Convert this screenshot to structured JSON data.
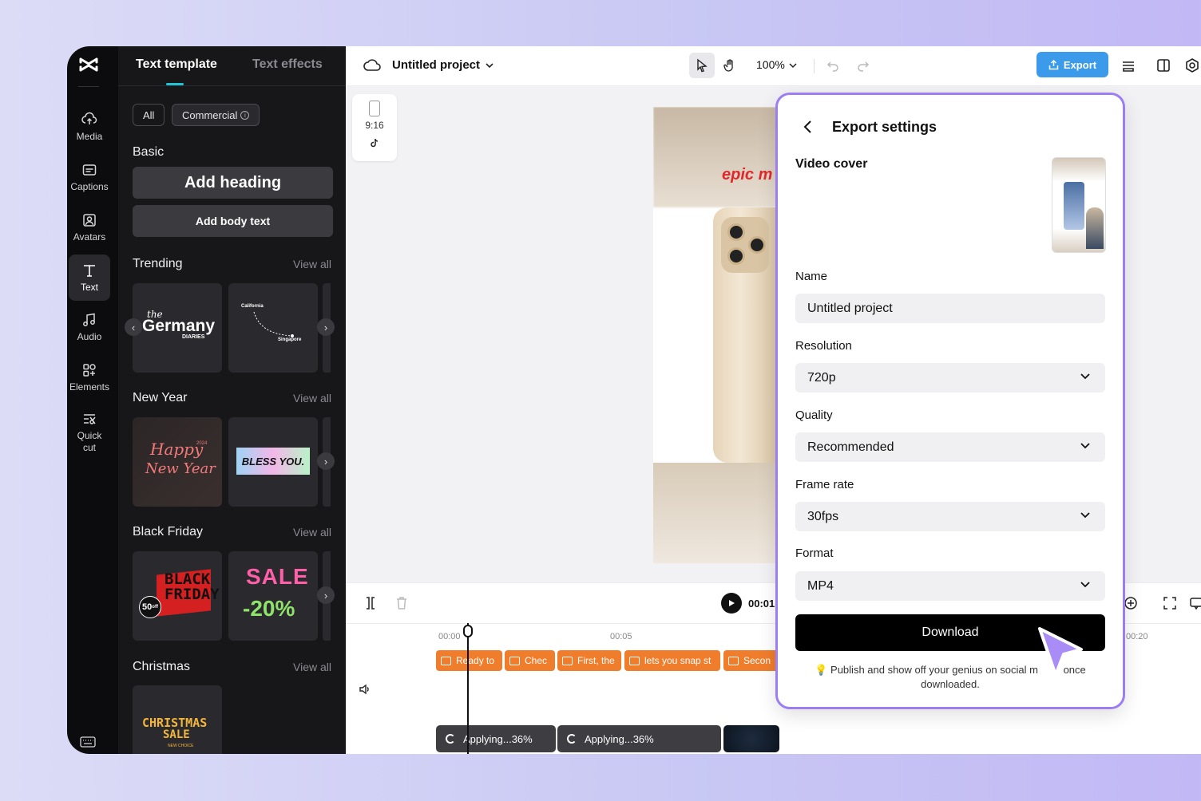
{
  "panel": {
    "tabs": [
      "Text template",
      "Text effects"
    ],
    "filters": {
      "all": "All",
      "commercial": "Commercial"
    },
    "basic": {
      "title": "Basic",
      "heading_btn": "Add heading",
      "body_btn": "Add body text"
    },
    "sections": [
      {
        "title": "Trending",
        "view_all": "View all"
      },
      {
        "title": "New Year",
        "view_all": "View all"
      },
      {
        "title": "Black Friday",
        "view_all": "View all"
      },
      {
        "title": "Christmas",
        "view_all": "View all"
      }
    ],
    "thumb_text": {
      "germany_the": "the",
      "germany": "Germany",
      "germany_sub": "DIARIES",
      "california": "California",
      "singapore": "Singapore",
      "happy": "Happy",
      "happy_year": "2024",
      "new_year": "New Year",
      "bless": "BLESS YOU.",
      "black": "BLACK",
      "friday": "FRIDAY",
      "fifty": "50",
      "off": "off",
      "sale": "SALE",
      "pct": "-20%",
      "christmas": "CHRISTMAS",
      "xsale": "SALE",
      "xsub": "NEW CHOICE"
    }
  },
  "rail": [
    {
      "label": "Media",
      "icon": "cloud-upload-icon"
    },
    {
      "label": "Captions",
      "icon": "captions-icon"
    },
    {
      "label": "Avatars",
      "icon": "avatar-icon"
    },
    {
      "label": "Text",
      "icon": "text-icon"
    },
    {
      "label": "Audio",
      "icon": "music-icon"
    },
    {
      "label": "Elements",
      "icon": "elements-icon"
    },
    {
      "label": "Quick cut",
      "icon": "quick-cut-icon"
    }
  ],
  "topbar": {
    "project_title": "Untitled project",
    "zoom": "100%",
    "export": "Export"
  },
  "canvas": {
    "ratio": "9:16",
    "overlay_text": "epic m"
  },
  "timeline": {
    "time": "00:01",
    "ticks": [
      "00:00",
      "00:05",
      "00:20"
    ],
    "captions": [
      "Ready to",
      "Chec",
      "First, the",
      "lets you snap st",
      "Secon"
    ],
    "applying": "Applying...36%"
  },
  "export_dialog": {
    "title": "Export settings",
    "video_cover": "Video cover",
    "name_label": "Name",
    "name_value": "Untitled project",
    "resolution_label": "Resolution",
    "resolution_value": "720p",
    "quality_label": "Quality",
    "quality_value": "Recommended",
    "framerate_label": "Frame rate",
    "framerate_value": "30fps",
    "format_label": "Format",
    "format_value": "MP4",
    "download": "Download",
    "note": "Publish and show off your genius on social m... once downloaded.",
    "note_line1": "Publish and show off your genius on social m",
    "note_line1_end": "once",
    "note_line2": "downloaded."
  },
  "colors": {
    "accent": "#3b9bea",
    "dialog_border": "#9d7df2",
    "caption_clip": "#f07d2b",
    "panel_bg": "#17171a",
    "tab_indicator": "#22c3d6"
  }
}
